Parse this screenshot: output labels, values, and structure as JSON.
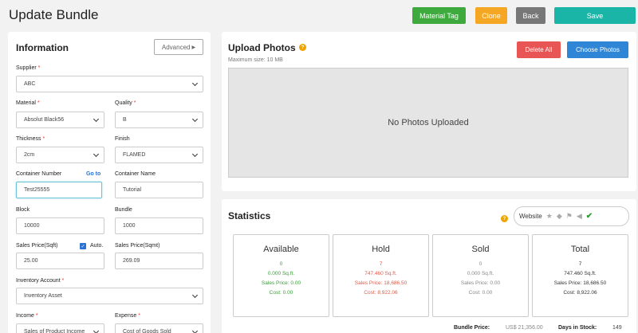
{
  "header": {
    "title": "Update Bundle",
    "material_tag_label": "Material Tag",
    "clone_label": "Clone",
    "back_label": "Back",
    "save_label": "Save"
  },
  "info": {
    "heading": "Information",
    "advanced_label": "Advanced",
    "supplier_label": "Supplier",
    "supplier_value": "ABC",
    "material_label": "Material",
    "material_value": "Absolut Black56",
    "quality_label": "Quality",
    "quality_value": "B",
    "thickness_label": "Thickness",
    "thickness_value": "2cm",
    "finish_label": "Finish",
    "finish_value": "FLAMED",
    "container_number_label": "Container Number",
    "goto_label": "Go to",
    "container_number_value": "Test25555",
    "container_name_label": "Container Name",
    "container_name_value": "Tutorial",
    "block_label": "Block",
    "block_value": "10000",
    "bundle_label": "Bundle",
    "bundle_value": "1000",
    "sales_price_sqft_label": "Sales Price(Sqft)",
    "auto_label": "Auto.",
    "sales_price_sqft_value": "25.00",
    "sales_price_sqmt_label": "Sales Price(Sqmt)",
    "sales_price_sqmt_value": "269.09",
    "inventory_account_label": "Inventory Account",
    "inventory_account_value": "Inventory Asset",
    "income_label": "Income",
    "income_value": "Sales of Product Income",
    "expense_label": "Expense",
    "expense_value": "Cost of Goods Sold",
    "required_mark": "*"
  },
  "upload": {
    "heading": "Upload Photos",
    "max_size": "Maximum size: 10 MB",
    "delete_all_label": "Delete All",
    "choose_photos_label": "Choose Photos",
    "empty_text": "No Photos Uploaded",
    "help_icon": "?"
  },
  "stats": {
    "heading": "Statistics",
    "channel_label": "Website",
    "help_icon": "?",
    "icons": [
      "star-icon",
      "tags-icon",
      "flag-icon",
      "megaphone-icon",
      "check-icon"
    ],
    "cards": [
      {
        "title": "Available",
        "count": "0",
        "sqft": "0.000 Sq.ft.",
        "sales_price": "Sales Price: 0.00",
        "cost": "Cost: 0.00"
      },
      {
        "title": "Hold",
        "count": "7",
        "sqft": "747.460 Sq.ft.",
        "sales_price": "Sales Price: 18,686.50",
        "cost": "Cost: 8,922.06"
      },
      {
        "title": "Sold",
        "count": "0",
        "sqft": "0.000 Sq.ft.",
        "sales_price": "Sales Price: 0.00",
        "cost": "Cost: 0.00"
      },
      {
        "title": "Total",
        "count": "7",
        "sqft": "747.460 Sq.ft.",
        "sales_price": "Sales Price: 18,686.50",
        "cost": "Cost: 8,922.06"
      }
    ],
    "bundle_price_label": "Bundle Price:",
    "bundle_price_value": "US$ 21,356.00",
    "days_in_stock_label": "Days in Stock:",
    "days_in_stock_value": "149"
  },
  "colors": {
    "save": "#1bb5a7",
    "material_tag": "#3eaa3e",
    "clone": "#f5a623",
    "back": "#777777",
    "delete": "#e85555",
    "choose": "#2f86d6"
  }
}
